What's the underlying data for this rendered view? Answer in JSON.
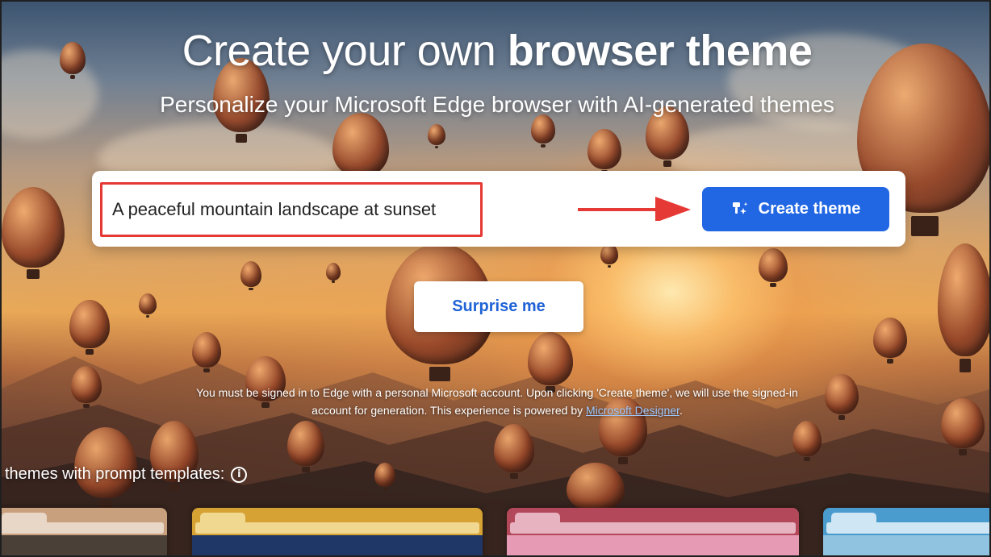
{
  "header": {
    "title_regular": "Create your own ",
    "title_bold": "browser theme",
    "subtitle": "Personalize your Microsoft Edge browser with AI-generated themes"
  },
  "prompt": {
    "value": "A peaceful mountain landscape at sunset",
    "create_label": "Create theme",
    "create_icon": "sparkle-brush-icon"
  },
  "surprise": {
    "label": "Surprise me"
  },
  "disclaimer": {
    "text": "You must be signed in to Edge with a personal Microsoft account. Upon clicking 'Create theme', we will use the signed-in account for generation. This experience is powered by ",
    "link_text": "Microsoft Designer",
    "suffix": "."
  },
  "templates": {
    "heading": "themes with prompt templates:",
    "info_icon": "info-icon",
    "cards": [
      {
        "frame_color": "#c9a07e",
        "bar_color": "#e8d6c6",
        "image_color": "#4a4038"
      },
      {
        "frame_color": "#d6a233",
        "bar_color": "#f0d890",
        "image_color": "#1f3766"
      },
      {
        "frame_color": "#b2485a",
        "bar_color": "#e8b3c0",
        "image_color": "#e69ab4"
      },
      {
        "frame_color": "#4a9ccf",
        "bar_color": "#cfe6f4",
        "image_color": "#8fc3e0"
      }
    ]
  },
  "colors": {
    "primary_button": "#2166e3",
    "annotation_red": "#e53935",
    "link": "#9ec8ff"
  }
}
